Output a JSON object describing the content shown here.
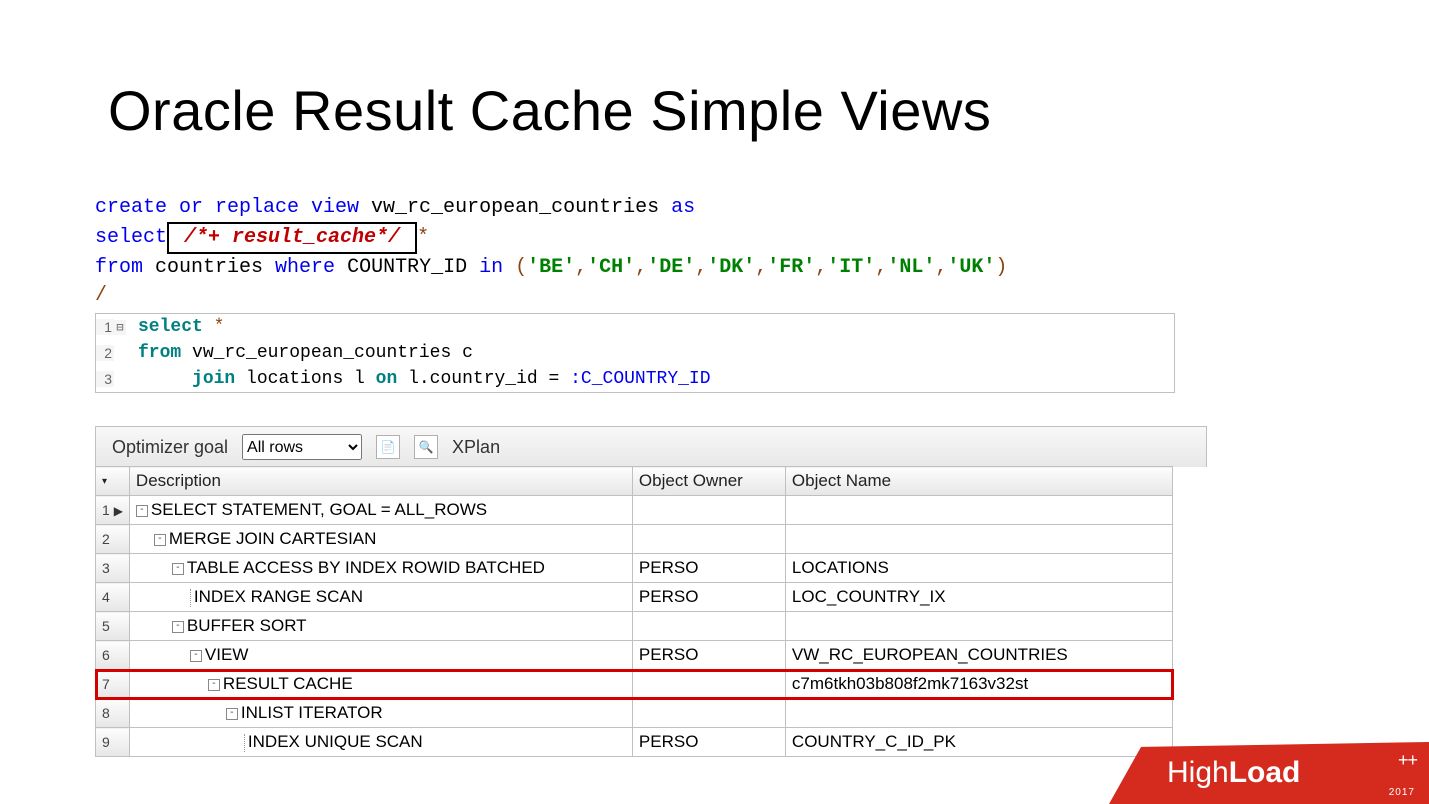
{
  "title": "Oracle Result Cache Simple Views",
  "sql1": {
    "l1a": "create or replace view",
    "l1b": " vw_rc_european_countries ",
    "l1c": "as",
    "l2a": "select",
    "hint": " /*+ result_cache*/ ",
    "l2c": "*",
    "l3a": "from",
    "l3b": " countries ",
    "l3c": "where",
    "l3d": " COUNTRY_ID ",
    "l3e": "in",
    "l3f": " (",
    "v1": "'BE'",
    "v2": "'CH'",
    "v3": "'DE'",
    "v4": "'DK'",
    "v5": "'FR'",
    "v6": "'IT'",
    "v7": "'NL'",
    "v8": "'UK'",
    "l3g": ")",
    "slash": "/"
  },
  "editor": {
    "line1_a": "select",
    "line1_b": " *",
    "line2_a": "from",
    "line2_b": " vw_rc_european_countries c",
    "line3_a": "     ",
    "line3_b": "join",
    "line3_c": " locations l ",
    "line3_d": "on",
    "line3_e": " l.country_id = ",
    "line3_f": ":C_COUNTRY_ID",
    "n1": "1",
    "n2": "2",
    "n3": "3"
  },
  "toolbar": {
    "label": "Optimizer goal",
    "select_value": "All rows",
    "xplan": "XPlan"
  },
  "columns": {
    "c1": "Description",
    "c2": "Object Owner",
    "c3": "Object Name"
  },
  "rows": [
    {
      "n": "1",
      "indent": 0,
      "icon": "-",
      "desc": "SELECT STATEMENT, GOAL = ALL_ROWS",
      "owner": "",
      "obj": "",
      "mark": "▶"
    },
    {
      "n": "2",
      "indent": 1,
      "icon": "-",
      "desc": "MERGE JOIN CARTESIAN",
      "owner": "",
      "obj": ""
    },
    {
      "n": "3",
      "indent": 2,
      "icon": "-",
      "desc": "TABLE ACCESS BY INDEX ROWID BATCHED",
      "owner": "PERSO",
      "obj": "LOCATIONS"
    },
    {
      "n": "4",
      "indent": 3,
      "icon": "",
      "desc": "INDEX RANGE SCAN",
      "owner": "PERSO",
      "obj": "LOC_COUNTRY_IX"
    },
    {
      "n": "5",
      "indent": 2,
      "icon": "-",
      "desc": "BUFFER SORT",
      "owner": "",
      "obj": ""
    },
    {
      "n": "6",
      "indent": 3,
      "icon": "-",
      "desc": "VIEW",
      "owner": "PERSO",
      "obj": "VW_RC_EUROPEAN_COUNTRIES"
    },
    {
      "n": "7",
      "indent": 4,
      "icon": "-",
      "desc": "RESULT CACHE",
      "owner": "",
      "obj": "c7m6tkh03b808f2mk7163v32st",
      "hl": true
    },
    {
      "n": "8",
      "indent": 5,
      "icon": "-",
      "desc": "INLIST ITERATOR",
      "owner": "",
      "obj": ""
    },
    {
      "n": "9",
      "indent": 6,
      "icon": "",
      "desc": "INDEX UNIQUE SCAN",
      "owner": "PERSO",
      "obj": "COUNTRY_C_ID_PK"
    }
  ],
  "logo": {
    "brand_a": "High",
    "brand_b": "Load",
    "plus": "++",
    "year": "2017"
  }
}
